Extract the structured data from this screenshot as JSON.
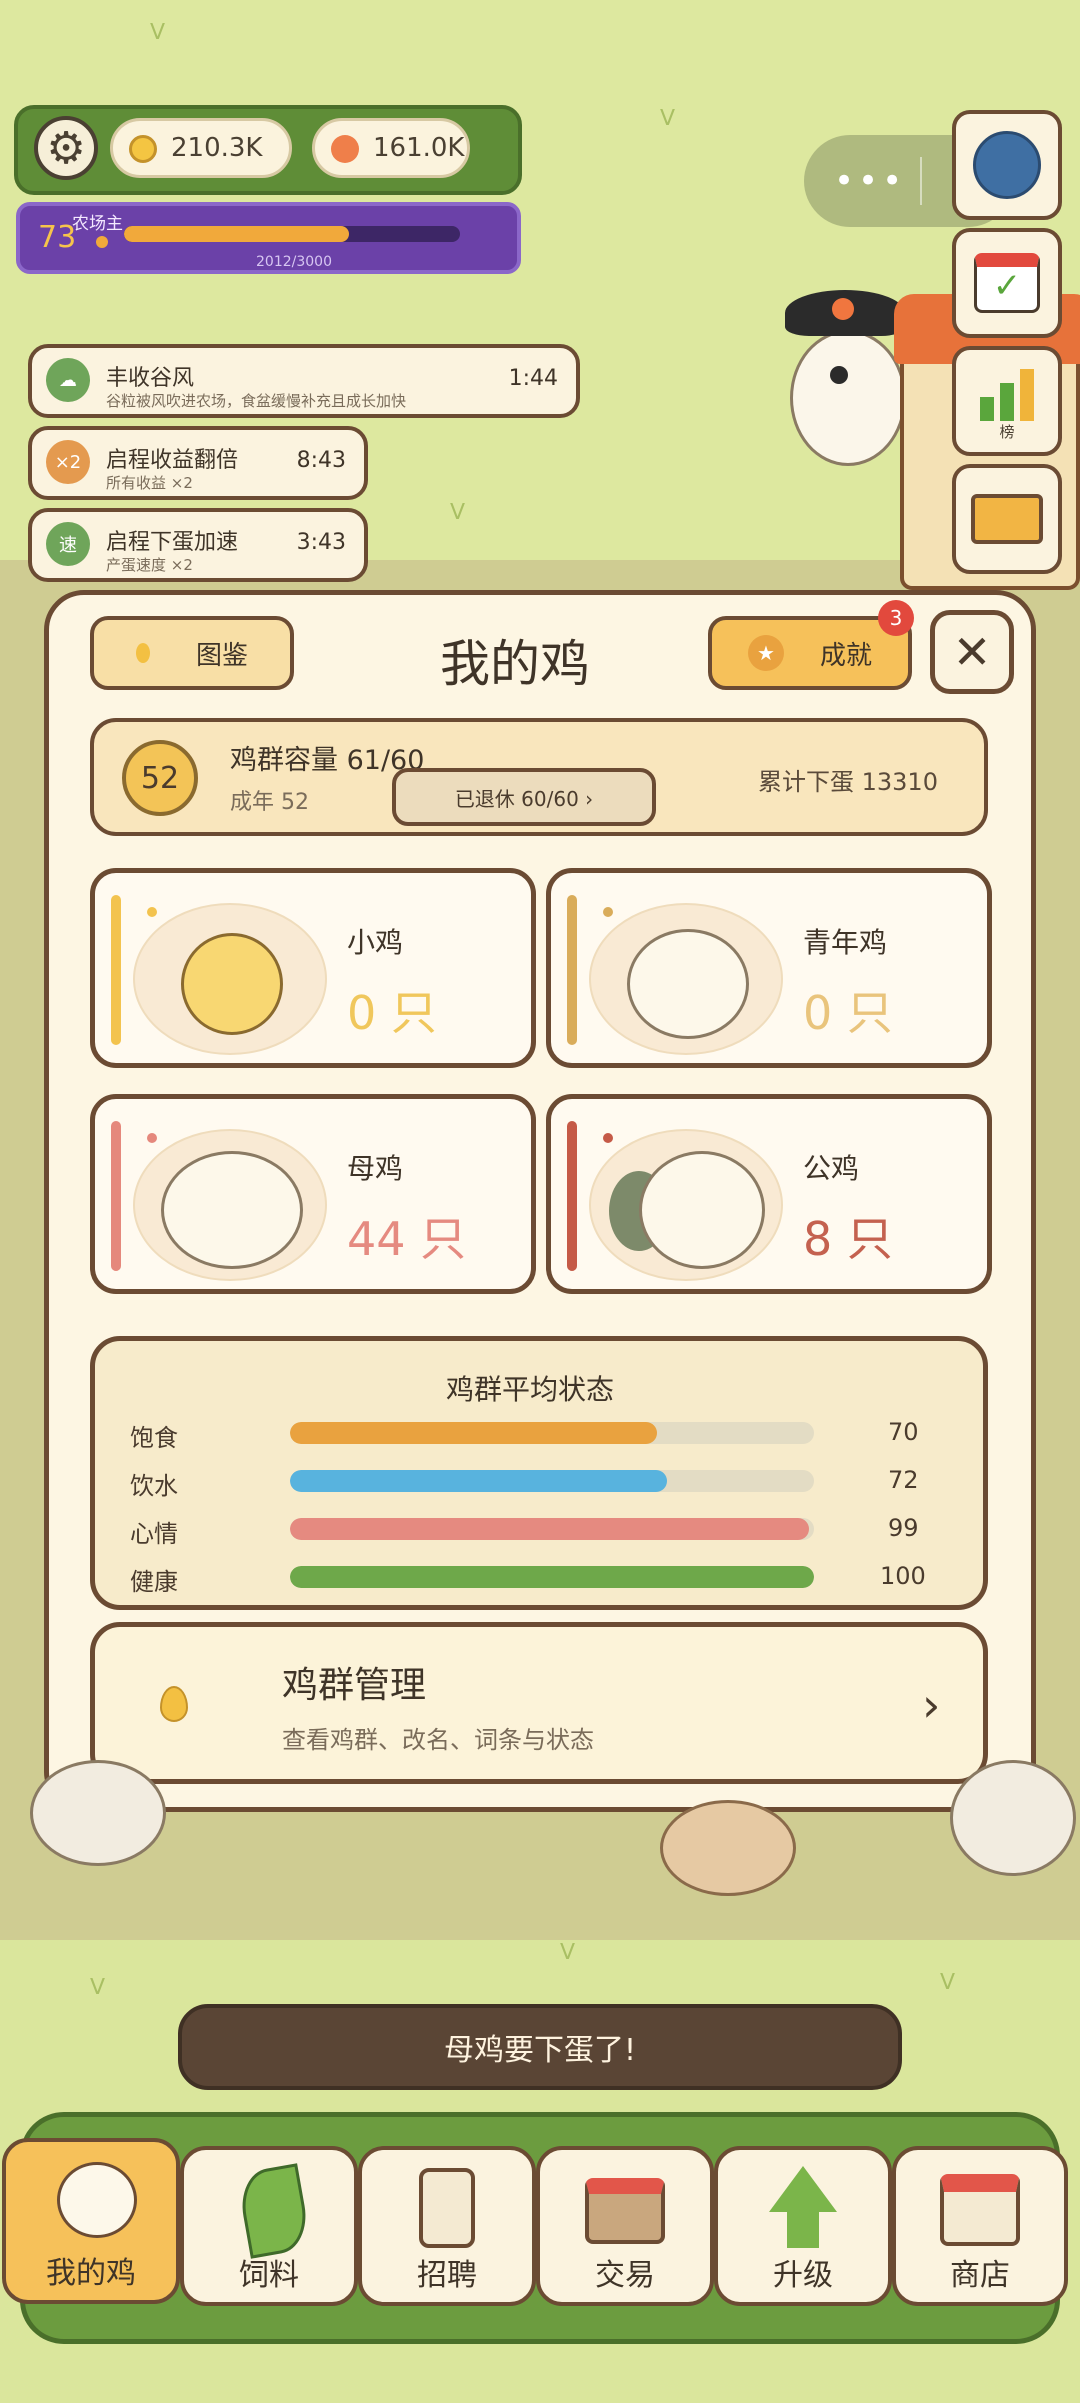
{
  "hud": {
    "coins": "210.3K",
    "gems": "161.0K",
    "level": "73",
    "level_title": "农场主",
    "xp_text": "2012/3000",
    "xp_fraction": 0.67,
    "coin_color": "#f4c542",
    "gem_color": "#ef7f4a"
  },
  "side_buttons": {
    "leaderboard_label": "榜"
  },
  "buffs": [
    {
      "icon": "cloud",
      "title": "丰收谷风",
      "subtitle": "谷粒被风吹进农场，食盆缓慢补充且成长加快",
      "time": "1:44",
      "color": "#6fa55a"
    },
    {
      "icon": "×2",
      "title": "启程收益翻倍",
      "subtitle": "所有收益 ×2",
      "time": "8:43",
      "color": "#e49a4f"
    },
    {
      "icon": "速",
      "title": "启程下蛋加速",
      "subtitle": "产蛋速度 ×2",
      "time": "3:43",
      "color": "#6fa55a"
    }
  ],
  "panel": {
    "title": "我的鸡",
    "catalog_label": "图鉴",
    "achievement_label": "成就",
    "achievement_badge": "3",
    "capacity_level": "52",
    "capacity_text": "鸡群容量 61/60",
    "adult_text": "成年 52",
    "retired_text": "已退休 60/60 ›",
    "total_eggs": "累计下蛋 13310"
  },
  "types": [
    {
      "name": "小鸡",
      "count": "0 只",
      "color": "#f3c34e",
      "count_color": "#f0c75c"
    },
    {
      "name": "青年鸡",
      "count": "0 只",
      "color": "#d9ac5a",
      "count_color": "#e9c47c"
    },
    {
      "name": "母鸡",
      "count": "44 只",
      "color": "#e5887c",
      "count_color": "#e58a80"
    },
    {
      "name": "公鸡",
      "count": "8 只",
      "color": "#c55a47",
      "count_color": "#c4614f"
    }
  ],
  "status": {
    "title": "鸡群平均状态",
    "rows": [
      {
        "label": "饱食",
        "value": "70",
        "fraction": 0.7,
        "color": "#e9a23f"
      },
      {
        "label": "饮水",
        "value": "72",
        "fraction": 0.72,
        "color": "#58b3de"
      },
      {
        "label": "心情",
        "value": "99",
        "fraction": 0.99,
        "color": "#e58a80"
      },
      {
        "label": "健康",
        "value": "100",
        "fraction": 1.0,
        "color": "#6ea84a"
      }
    ]
  },
  "manage": {
    "title": "鸡群管理",
    "subtitle": "查看鸡群、改名、词条与状态",
    "arrow": "›"
  },
  "toast": "母鸡要下蛋了!",
  "nav": [
    {
      "label": "我的鸡",
      "icon": "chicken-icon",
      "active": true
    },
    {
      "label": "饲料",
      "icon": "leaf-icon",
      "active": false
    },
    {
      "label": "招聘",
      "icon": "badge-icon",
      "active": false
    },
    {
      "label": "交易",
      "icon": "market-icon",
      "active": false
    },
    {
      "label": "升级",
      "icon": "arrow-up-icon",
      "active": false
    },
    {
      "label": "商店",
      "icon": "shop-icon",
      "active": false
    }
  ]
}
